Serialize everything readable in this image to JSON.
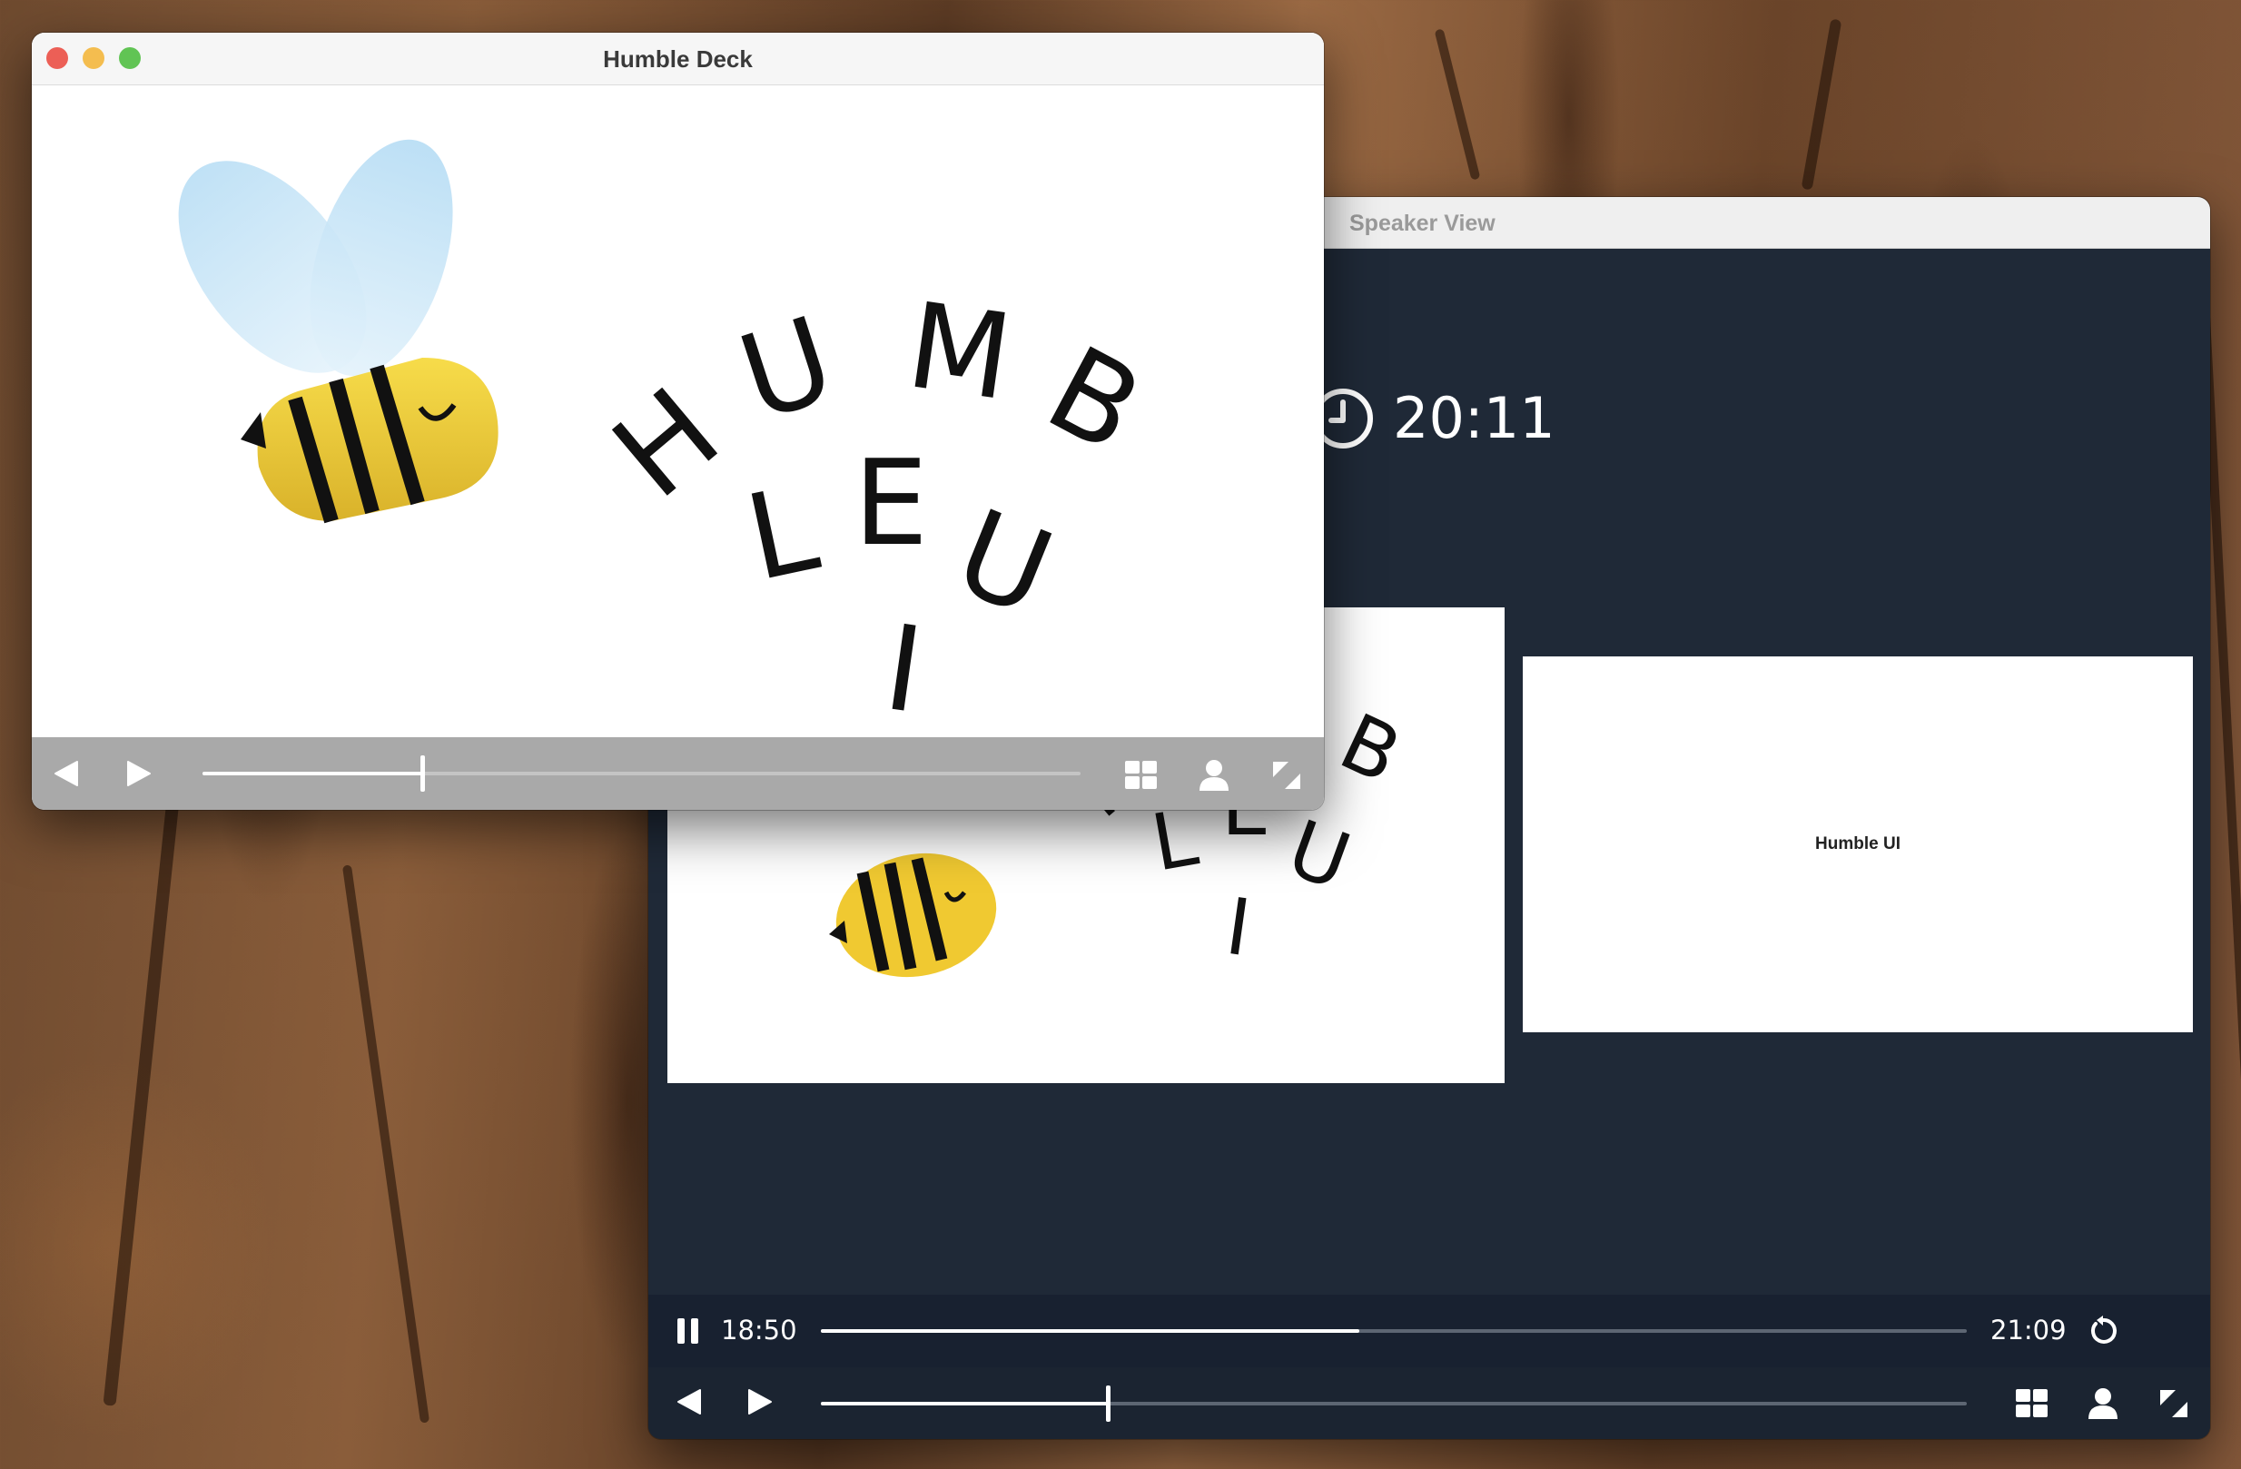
{
  "main_window": {
    "title": "Humble Deck",
    "slide_word": "HUMBLE UI",
    "progress_fraction": 0.25
  },
  "speaker_window": {
    "title": "Speaker View",
    "clock": "20:11",
    "next_slide_text": "Humble UI",
    "elapsed": "18:50",
    "remaining": "21:09",
    "timer_progress_fraction": 0.47,
    "slide_progress_fraction": 0.25
  },
  "icons": [
    "prev-icon",
    "next-icon",
    "grid-icon",
    "person-icon",
    "fullscreen-icon",
    "pause-icon",
    "reset-icon",
    "clock-icon"
  ],
  "colors": {
    "speaker_bg": "#1f2937",
    "bee_yellow": "#f5d33a",
    "wing_blue": "#bfe3f7",
    "close": "#ec5f56",
    "minimize": "#f4bd4f",
    "zoom": "#61c454"
  }
}
